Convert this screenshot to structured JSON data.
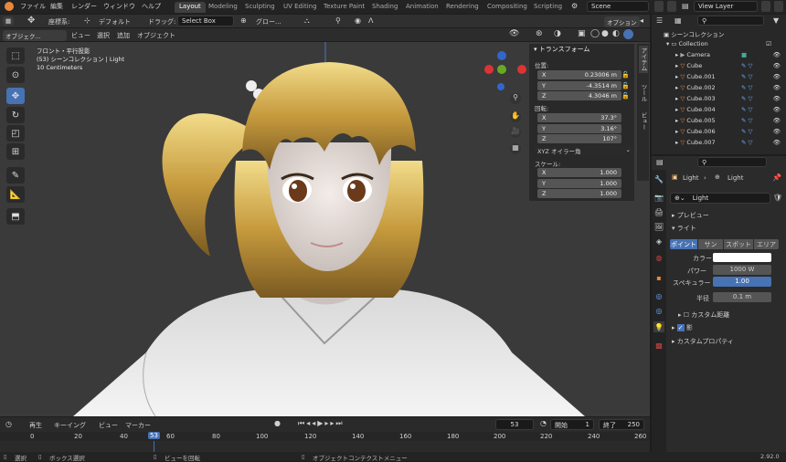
{
  "topbar": {
    "menus": [
      "ファイル",
      "編集",
      "レンダー",
      "ウィンドウ",
      "ヘルプ"
    ],
    "workspaces": [
      "Layout",
      "Modeling",
      "Sculpting",
      "UV Editing",
      "Texture Paint",
      "Shading",
      "Animation",
      "Rendering",
      "Compositing",
      "Scripting"
    ],
    "active_workspace": "Layout",
    "scene": "Scene",
    "view_layer": "View Layer"
  },
  "viewport_header": {
    "coord_label": "座標系:",
    "coord_value": "デフォルト",
    "drag_label": "ドラッグ:",
    "drag_value": "Select Box",
    "pivot_label": "グロー...",
    "options": "オプション"
  },
  "viewport_header2": {
    "mode": "オブジェク...",
    "menus": [
      "ビュー",
      "選択",
      "追加",
      "オブジェクト"
    ]
  },
  "viewport_info": {
    "line1": "フロント・平行投影",
    "line2": "(53) シーンコレクション | Light",
    "line3": "10 Centimeters"
  },
  "transform": {
    "title": "トランスフォーム",
    "location_label": "位置:",
    "location": [
      {
        "axis": "X",
        "value": "0.23006 m"
      },
      {
        "axis": "Y",
        "value": "-4.3514 m"
      },
      {
        "axis": "Z",
        "value": "4.3046 m"
      }
    ],
    "rotation_label": "回転:",
    "rotation": [
      {
        "axis": "X",
        "value": "37.3°"
      },
      {
        "axis": "Y",
        "value": "3.16°"
      },
      {
        "axis": "Z",
        "value": "107°"
      }
    ],
    "rotation_mode": "XYZ オイラー角",
    "scale_label": "スケール:",
    "scale": [
      {
        "axis": "X",
        "value": "1.000"
      },
      {
        "axis": "Y",
        "value": "1.000"
      },
      {
        "axis": "Z",
        "value": "1.000"
      }
    ],
    "side_tabs": [
      "アイテム",
      "ツール",
      "ビュー"
    ]
  },
  "outliner": {
    "header": "シーンコレクション",
    "collection": "Collection",
    "items": [
      "Camera",
      "Cube",
      "Cube.001",
      "Cube.002",
      "Cube.003",
      "Cube.004",
      "Cube.005",
      "Cube.006",
      "Cube.007"
    ]
  },
  "properties": {
    "breadcrumb_obj": "Light",
    "breadcrumb_data": "Light",
    "data_name": "Light",
    "preview": "プレビュー",
    "light_section": "ライト",
    "light_types": [
      "ポイント",
      "サン",
      "スポット",
      "エリア"
    ],
    "active_type": "ポイント",
    "color_label": "カラー",
    "power_label": "パワー",
    "power_value": "1000 W",
    "specular_label": "スペキュラー",
    "specular_value": "1.00",
    "radius_label": "半径",
    "radius_value": "0.1 m",
    "custom_distance": "カスタム距離",
    "shadow": "影",
    "custom_props": "カスタムプロパティ"
  },
  "timeline": {
    "menus": [
      "再生",
      "キーイング",
      "ビュー",
      "マーカー"
    ],
    "current_frame": "53",
    "start_label": "開始",
    "start_value": "1",
    "end_label": "終了",
    "end_value": "250",
    "ticks": [
      "0",
      "20",
      "40",
      "53",
      "60",
      "80",
      "100",
      "120",
      "140",
      "160",
      "180",
      "200",
      "220",
      "240",
      "260"
    ]
  },
  "statusbar": {
    "select": "選択",
    "box_select": "ボックス選択",
    "rotate_view": "ビューを回転",
    "context_menu": "オブジェクトコンテクストメニュー",
    "version": "2.92.0"
  },
  "colors": {
    "accent": "#4772b3",
    "frame_marker": "#4772b3",
    "light_icon": "#e8883a"
  }
}
